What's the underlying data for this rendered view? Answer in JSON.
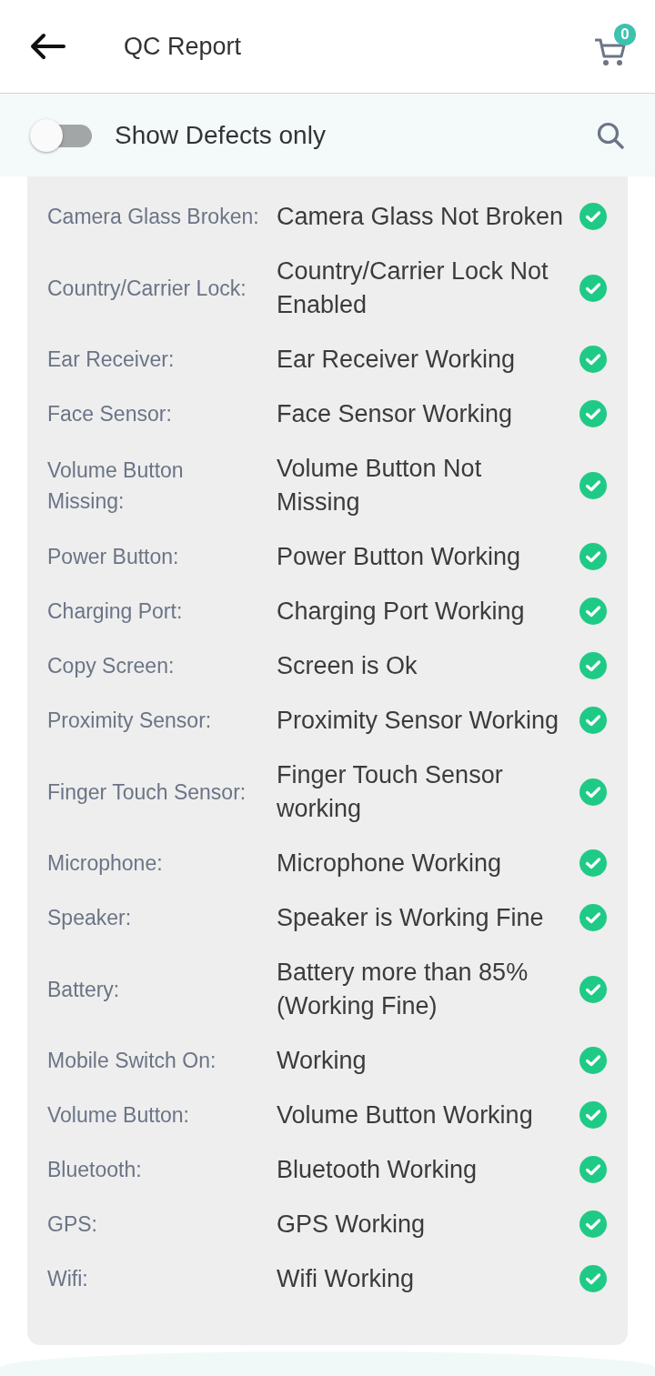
{
  "header": {
    "title": "QC Report",
    "cart_count": "0"
  },
  "filter": {
    "toggle": {
      "label": "Show Defects only",
      "on": false
    }
  },
  "checks": [
    {
      "label": "Camera Glass Broken:",
      "value": "Camera Glass Not Broken",
      "passed": true
    },
    {
      "label": "Country/Carrier Lock:",
      "value": "Country/Carrier Lock Not Enabled",
      "passed": true
    },
    {
      "label": "Ear Receiver:",
      "value": "Ear Receiver Working",
      "passed": true
    },
    {
      "label": "Face Sensor:",
      "value": "Face Sensor Working",
      "passed": true
    },
    {
      "label": "Volume Button Missing:",
      "value": "Volume Button Not Missing",
      "passed": true
    },
    {
      "label": "Power Button:",
      "value": "Power Button Working",
      "passed": true
    },
    {
      "label": "Charging Port:",
      "value": "Charging Port Working",
      "passed": true
    },
    {
      "label": "Copy Screen:",
      "value": "Screen is Ok",
      "passed": true
    },
    {
      "label": "Proximity Sensor:",
      "value": "Proximity Sensor Working",
      "passed": true
    },
    {
      "label": "Finger Touch Sensor:",
      "value": "Finger Touch Sensor working",
      "passed": true
    },
    {
      "label": "Microphone:",
      "value": "Microphone Working",
      "passed": true
    },
    {
      "label": "Speaker:",
      "value": "Speaker is Working Fine",
      "passed": true
    },
    {
      "label": "Battery:",
      "value": "Battery more than 85% (Working Fine)",
      "passed": true
    },
    {
      "label": "Mobile Switch On:",
      "value": "Working",
      "passed": true
    },
    {
      "label": "Volume Button:",
      "value": "Volume Button Working",
      "passed": true
    },
    {
      "label": "Bluetooth:",
      "value": "Bluetooth Working",
      "passed": true
    },
    {
      "label": "GPS:",
      "value": "GPS Working",
      "passed": true
    },
    {
      "label": "Wifi:",
      "value": "Wifi Working",
      "passed": true
    }
  ]
}
